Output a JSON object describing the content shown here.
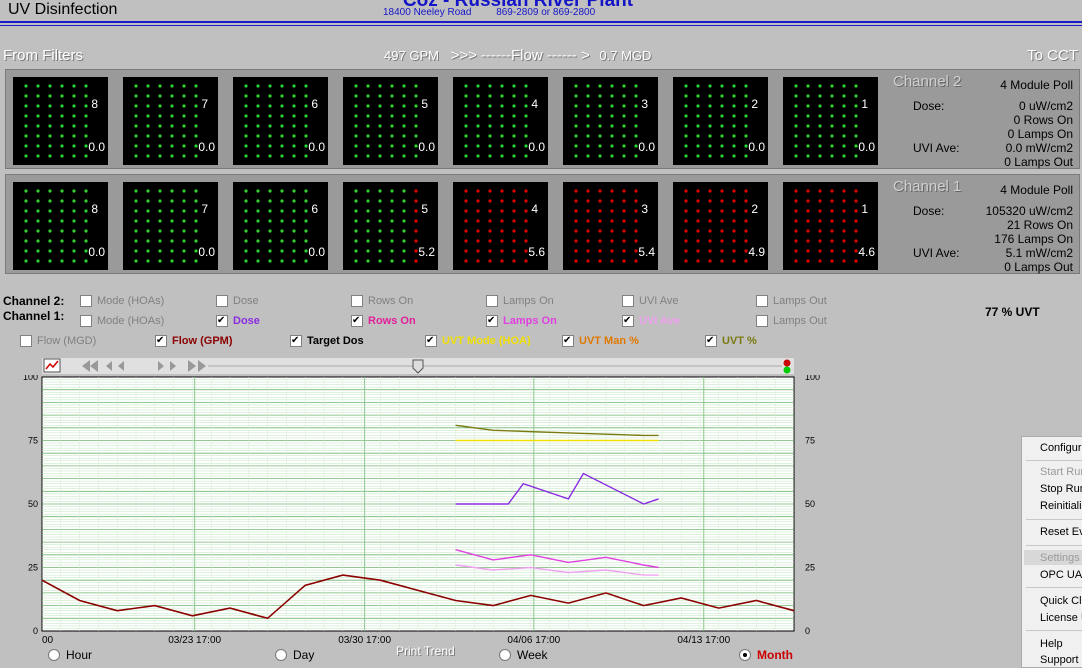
{
  "header": {
    "window_title": "UV Disinfection",
    "plant_title": "Coz - Russian River Plant",
    "address": "18400 Neeley Road",
    "phones": "869-2809 or 869-2800"
  },
  "flow": {
    "from_label": "From Filters",
    "to_label": "To CCT",
    "gpm_value": "497",
    "gpm_unit": "GPM",
    "arrow_text": ">>> ------Flow ------ >",
    "mgd_value": "0.7",
    "mgd_unit": "MGD"
  },
  "channels": [
    {
      "name": "Channel 2",
      "poll": "4 Module Poll",
      "dose_label": "Dose:",
      "dose_value": "0 uW/cm2",
      "rows_on": "0 Rows On",
      "lamps_on": "0 Lamps On",
      "uvi_label": "UVI Ave:",
      "uvi_value": "0.0 mW/cm2",
      "lamps_out": "0 Lamps Out",
      "modules": [
        {
          "num": "8",
          "value": "0.0",
          "red_cols": 0
        },
        {
          "num": "7",
          "value": "0.0",
          "red_cols": 0
        },
        {
          "num": "6",
          "value": "0.0",
          "red_cols": 0
        },
        {
          "num": "5",
          "value": "0.0",
          "red_cols": 0
        },
        {
          "num": "4",
          "value": "0.0",
          "red_cols": 0
        },
        {
          "num": "3",
          "value": "0.0",
          "red_cols": 0
        },
        {
          "num": "2",
          "value": "0.0",
          "red_cols": 0
        },
        {
          "num": "1",
          "value": "0.0",
          "red_cols": 0
        }
      ]
    },
    {
      "name": "Channel 1",
      "poll": "4 Module Poll",
      "dose_label": "Dose:",
      "dose_value": "105320 uW/cm2",
      "rows_on": "21 Rows On",
      "lamps_on": "176 Lamps On",
      "uvi_label": "UVI Ave:",
      "uvi_value": "5.1 mW/cm2",
      "lamps_out": "0 Lamps Out",
      "modules": [
        {
          "num": "8",
          "value": "0.0",
          "red_cols": 0
        },
        {
          "num": "7",
          "value": "0.0",
          "red_cols": 0
        },
        {
          "num": "6",
          "value": "0.0",
          "red_cols": 0
        },
        {
          "num": "5",
          "value": "5.2",
          "red_cols": 1
        },
        {
          "num": "4",
          "value": "5.6",
          "red_cols": 6
        },
        {
          "num": "3",
          "value": "5.4",
          "red_cols": 6
        },
        {
          "num": "2",
          "value": "4.9",
          "red_cols": 6
        },
        {
          "num": "1",
          "value": "4.6",
          "red_cols": 6
        }
      ]
    }
  ],
  "trend_options": {
    "ch2_label": "Channel 2:",
    "ch1_label": "Channel 1:",
    "ch2": [
      {
        "label": "Mode (HOAs)",
        "checked": false,
        "color": "#808080"
      },
      {
        "label": "Dose",
        "checked": false,
        "color": "#808080"
      },
      {
        "label": "Rows On",
        "checked": false,
        "color": "#808080"
      },
      {
        "label": "Lamps On",
        "checked": false,
        "color": "#808080"
      },
      {
        "label": "UVI Ave",
        "checked": false,
        "color": "#808080"
      },
      {
        "label": "Lamps  Out",
        "checked": false,
        "color": "#808080"
      }
    ],
    "ch1": [
      {
        "label": "Mode (HOAs)",
        "checked": false,
        "color": "#808080"
      },
      {
        "label": "Dose",
        "checked": true,
        "color": "#8a2be2"
      },
      {
        "label": "Rows On",
        "checked": true,
        "color": "#e0209a"
      },
      {
        "label": "Lamps On",
        "checked": true,
        "color": "#e040e0"
      },
      {
        "label": "UVI Ave",
        "checked": true,
        "color": "#f0a0f0"
      },
      {
        "label": "Lamps  Out",
        "checked": false,
        "color": "#808080"
      }
    ],
    "plant": [
      {
        "label": "Flow (MGD)",
        "checked": false,
        "color": "#808080"
      },
      {
        "label": "Flow (GPM)",
        "checked": true,
        "color": "#8b0000"
      },
      {
        "label": "Target Dos",
        "checked": true,
        "color": "#000000"
      },
      {
        "label": "UVT Mode (HOA)",
        "checked": true,
        "color": "#f0e000"
      },
      {
        "label": "UVT Man %",
        "checked": true,
        "color": "#e07800"
      },
      {
        "label": "UVT %",
        "checked": true,
        "color": "#7a7a10"
      }
    ],
    "uvt_reading": "77 % UVT"
  },
  "chart_data": {
    "type": "line",
    "ylim": [
      0,
      100
    ],
    "y_ticks": [
      "0",
      "25",
      "50",
      "75",
      "100"
    ],
    "x_tick_labels": [
      "00",
      "03/23 17:00",
      "03/30 17:00",
      "04/06 17:00",
      "04/13 17:00"
    ],
    "series": [
      {
        "name": "Flow (GPM)",
        "color": "#8b0000",
        "x": [
          0,
          0.05,
          0.1,
          0.15,
          0.2,
          0.25,
          0.3,
          0.35,
          0.4,
          0.45,
          0.5,
          0.55,
          0.6,
          0.65,
          0.7,
          0.75,
          0.8,
          0.85,
          0.9,
          0.95,
          1.0
        ],
        "values": [
          20,
          12,
          8,
          10,
          6,
          9,
          5,
          18,
          22,
          20,
          16,
          12,
          10,
          14,
          11,
          15,
          10,
          13,
          9,
          12,
          8
        ]
      },
      {
        "name": "UVT %",
        "color": "#7a7a10",
        "x": [
          0.55,
          0.6,
          0.7,
          0.8,
          0.82
        ],
        "values": [
          81,
          79,
          78,
          77,
          77
        ]
      },
      {
        "name": "UVT Mode (HOA)",
        "color": "#f0e000",
        "x": [
          0.55,
          0.82
        ],
        "values": [
          75,
          75
        ]
      },
      {
        "name": "Dose",
        "color": "#8a2be2",
        "x": [
          0.55,
          0.62,
          0.64,
          0.7,
          0.72,
          0.8,
          0.82
        ],
        "values": [
          50,
          50,
          58,
          52,
          62,
          50,
          52
        ]
      },
      {
        "name": "Lamps On",
        "color": "#e040e0",
        "x": [
          0.55,
          0.6,
          0.65,
          0.7,
          0.75,
          0.8,
          0.82
        ],
        "values": [
          32,
          28,
          30,
          27,
          29,
          26,
          25
        ]
      },
      {
        "name": "UVI Ave",
        "color": "#f0a0f0",
        "x": [
          0.55,
          0.6,
          0.65,
          0.7,
          0.75,
          0.8,
          0.82
        ],
        "values": [
          26,
          24,
          25,
          23,
          24,
          22,
          22
        ]
      }
    ]
  },
  "print_trend": {
    "label": "Print Trend",
    "options": [
      {
        "label": "Hour",
        "selected": false
      },
      {
        "label": "Day",
        "selected": false
      },
      {
        "label": "Week",
        "selected": false
      },
      {
        "label": "Month",
        "selected": true
      }
    ]
  },
  "context_menu": {
    "items": [
      {
        "label": "Configura",
        "disabled": false
      },
      {
        "label": "Start Run",
        "disabled": true
      },
      {
        "label": "Stop Run",
        "disabled": false
      },
      {
        "label": "Reinitializ",
        "disabled": false
      },
      {
        "label": "Reset Ev",
        "disabled": false
      },
      {
        "label": "Settings",
        "disabled": true
      },
      {
        "label": "OPC UA C",
        "disabled": false
      },
      {
        "label": "Quick Cli",
        "disabled": false
      },
      {
        "label": "License U",
        "disabled": false
      },
      {
        "label": "Help",
        "disabled": false
      },
      {
        "label": "Support",
        "disabled": false
      }
    ]
  }
}
